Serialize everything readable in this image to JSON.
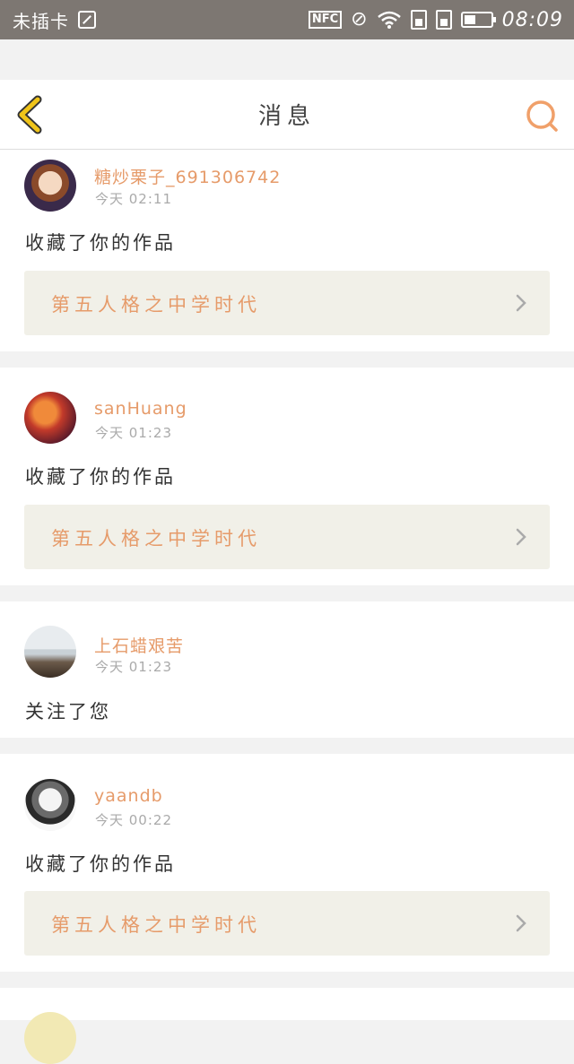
{
  "status_bar": {
    "carrier": "未插卡",
    "nfc": "NFC",
    "time": "08:09"
  },
  "header": {
    "title": "消息",
    "back_icon": "chevron-left-icon",
    "search_icon": "search-icon",
    "accent": "#e6b10c",
    "search_color": "#f0a06a"
  },
  "notifications": [
    {
      "username": "糖炒栗子_691306742",
      "time": "今天 02:11",
      "action": "收藏了你的作品",
      "work_title": "第五人格之中学时代"
    },
    {
      "username": "sanHuang",
      "time": "今天 01:23",
      "action": "收藏了你的作品",
      "work_title": "第五人格之中学时代"
    },
    {
      "username": "上石蜡艰苦",
      "time": "今天 01:23",
      "action": "关注了您"
    },
    {
      "username": "yaandb",
      "time": "今天 00:22",
      "action": "收藏了你的作品",
      "work_title": "第五人格之中学时代"
    }
  ],
  "colors": {
    "username": "#e69b6a",
    "work_bg": "#f1f0e8",
    "page_bg": "#f2f2f2"
  }
}
